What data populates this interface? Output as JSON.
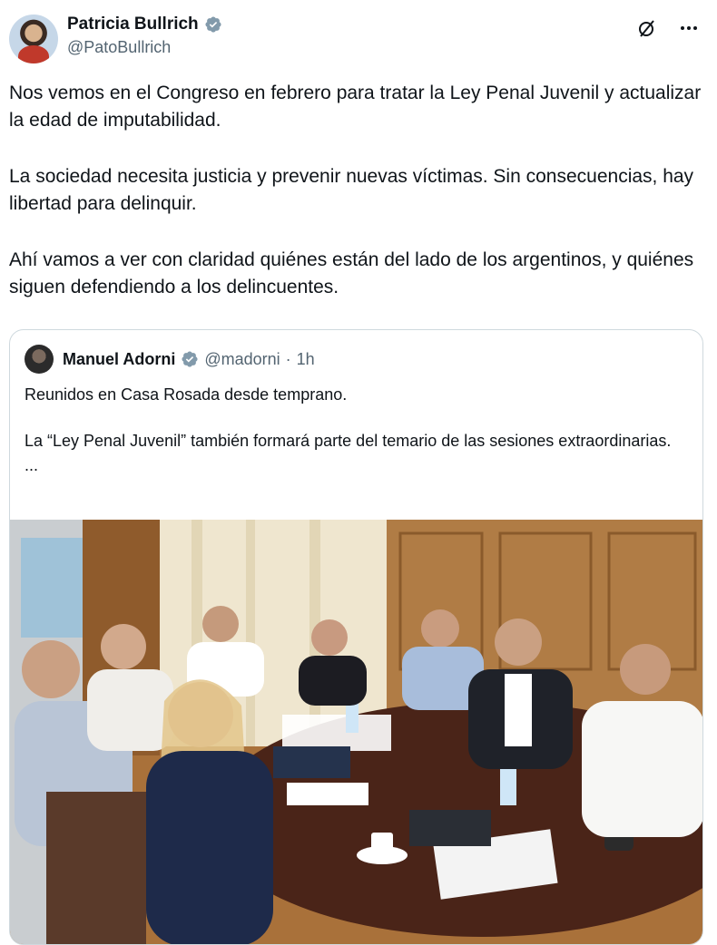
{
  "author": {
    "display_name": "Patricia Bullrich",
    "handle": "@PatoBullrich"
  },
  "tweet": {
    "paragraphs": [
      "Nos vemos en el Congreso en febrero para tratar la Ley Penal Juvenil y actualizar la edad de imputabilidad.",
      "La sociedad necesita justicia y prevenir nuevas víctimas. Sin consecuencias, hay libertad para delinquir.",
      "Ahí vamos a ver con claridad quiénes están del lado de los argentinos, y quiénes siguen defendiendo a los delincuentes."
    ]
  },
  "quote": {
    "display_name": "Manuel Adorni",
    "handle": "@madorni",
    "separator": "·",
    "time": "1h",
    "paragraphs": [
      "Reunidos en Casa Rosada desde temprano.",
      "La “Ley Penal Juvenil” también formará parte del temario de las sesiones extraordinarias.",
      "..."
    ]
  },
  "icons": {
    "verified": "verified-badge-icon",
    "grok": "grok-icon",
    "more": "more-icon"
  },
  "colors": {
    "verified_blue": "#829aab",
    "text": "#0f1419",
    "secondary": "#536471",
    "border": "#cfd9de"
  }
}
